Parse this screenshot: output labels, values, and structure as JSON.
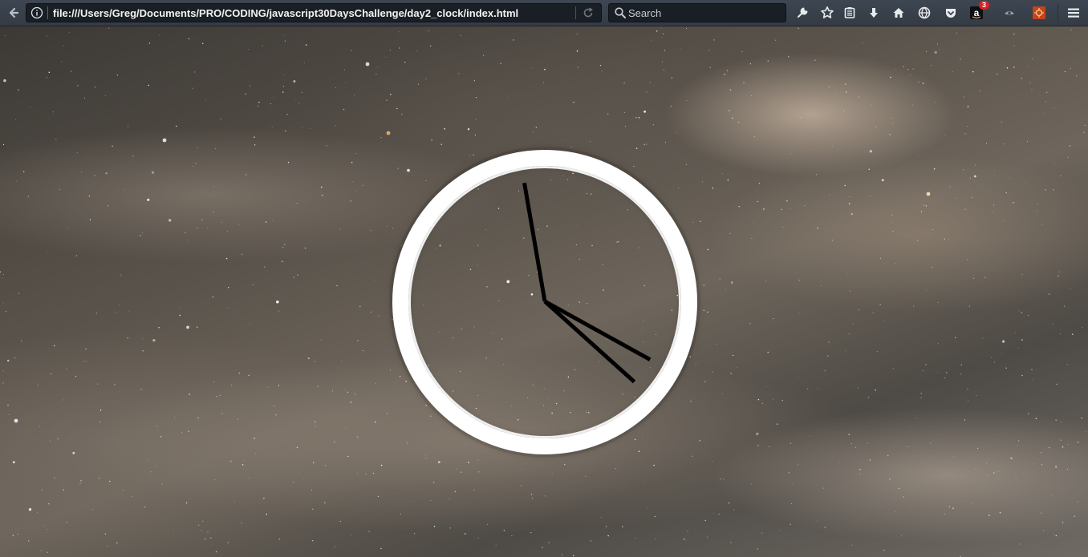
{
  "browser": {
    "url": "file:///Users/Greg/Documents/PRO/CODING/javascript30DaysChallenge/day2_clock/index.html",
    "search_placeholder": "Search",
    "toolbar_icons": [
      "wrench-icon",
      "bookmark-star-icon",
      "reading-list-icon",
      "download-icon",
      "home-icon",
      "globe-icon",
      "pocket-icon",
      "amazon-icon",
      "eye-icon",
      "extension-icon",
      "menu-icon"
    ],
    "amazon_badge": "3",
    "badge_color": "#d92121"
  },
  "clock": {
    "hour": 3,
    "minute": 58,
    "second": 22,
    "face_color": "#ffffff",
    "hand_color": "#000000"
  }
}
